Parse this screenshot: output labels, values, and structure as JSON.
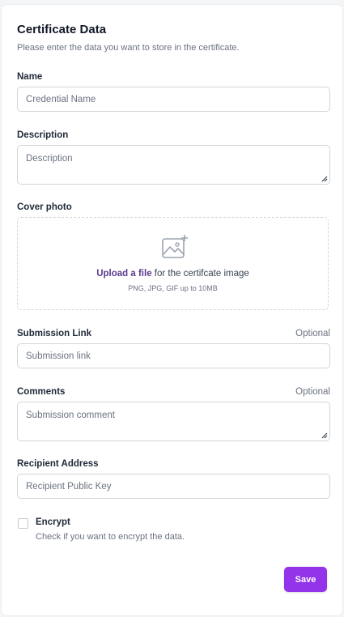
{
  "form": {
    "title": "Certificate Data",
    "subtitle": "Please enter the data you want to store in the certificate.",
    "name": {
      "label": "Name",
      "placeholder": "Credential Name"
    },
    "description": {
      "label": "Description",
      "placeholder": "Description"
    },
    "cover": {
      "label": "Cover photo",
      "upload_link": "Upload a file",
      "upload_text": " for the certifcate image",
      "hint": "PNG, JPG, GIF up to 10MB",
      "icon": "image-add-icon"
    },
    "submission_link": {
      "label": "Submission Link",
      "optional": "Optional",
      "placeholder": "Submission link"
    },
    "comments": {
      "label": "Comments",
      "optional": "Optional",
      "placeholder": "Submission comment"
    },
    "recipient": {
      "label": "Recipient Address",
      "placeholder": "Recipient Public Key"
    },
    "encrypt": {
      "label": "Encrypt",
      "help": "Check if you want to encrypt the data.",
      "checked": false
    },
    "save_label": "Save"
  },
  "colors": {
    "accent": "#9333ea",
    "link": "#5b3a8f",
    "border": "#d1d5db"
  }
}
